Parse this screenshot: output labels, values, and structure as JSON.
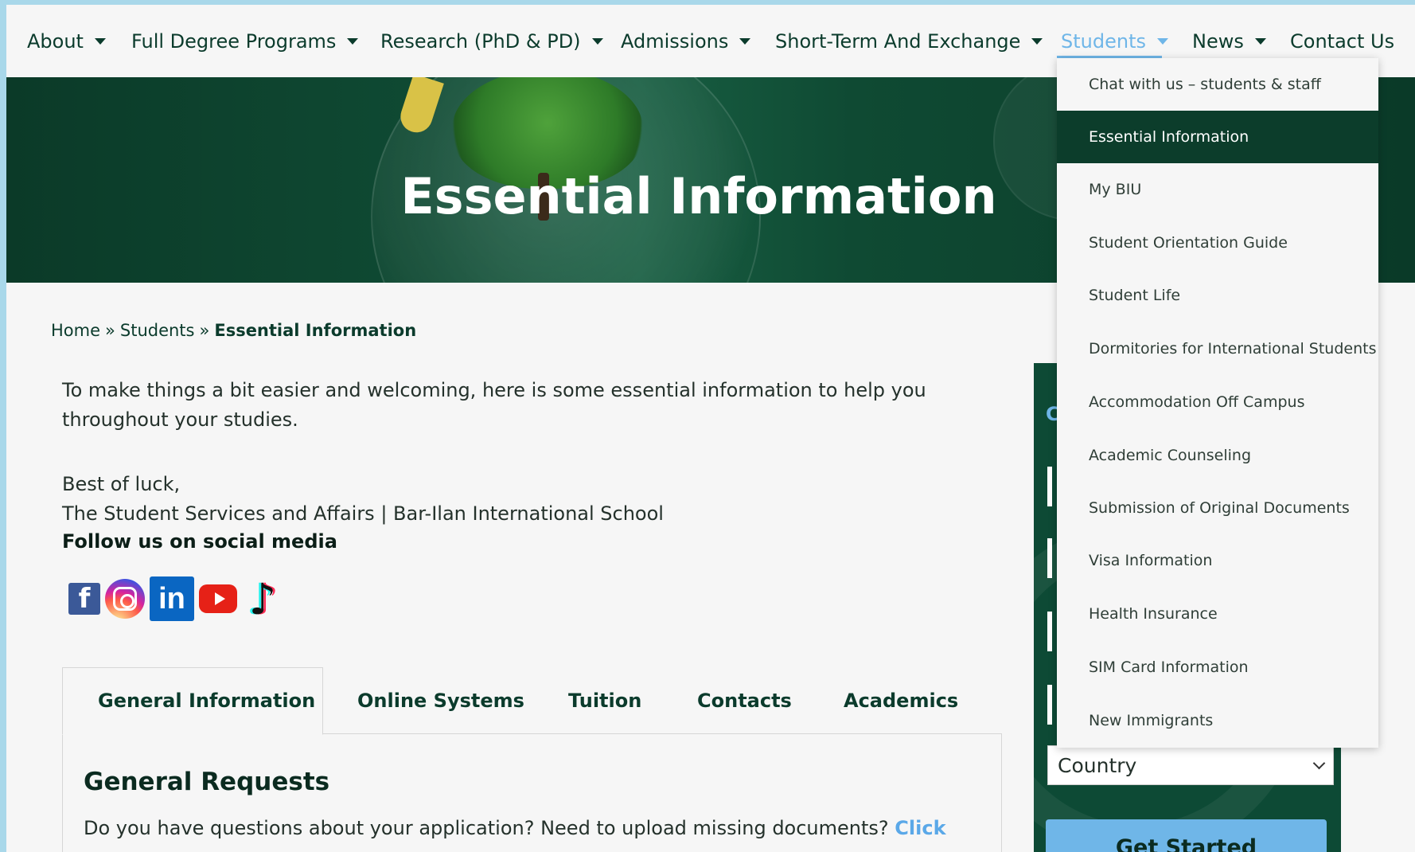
{
  "nav": {
    "items": [
      {
        "label": "About",
        "has_caret": true
      },
      {
        "label": "Full Degree Programs",
        "has_caret": true
      },
      {
        "label": "Research (PhD & PD)",
        "has_caret": true
      },
      {
        "label": "Admissions",
        "has_caret": true
      },
      {
        "label": "Short-Term And Exchange",
        "has_caret": true
      },
      {
        "label": "Students",
        "has_caret": true,
        "active": true
      },
      {
        "label": "News",
        "has_caret": true
      },
      {
        "label": "Contact Us",
        "has_caret": false
      }
    ]
  },
  "hero": {
    "title": "Essential Information"
  },
  "breadcrumb": {
    "home": "Home",
    "separator": "»",
    "parent": "Students",
    "current": "Essential Information"
  },
  "content": {
    "intro": "To make things a bit easier and welcoming, here is some essential information to help you throughout your studies.",
    "luck": "Best of luck,",
    "signature": "The Student Services and Affairs | Bar-Ilan International School",
    "follow": "Follow us on social media"
  },
  "social": {
    "icons": [
      "facebook-icon",
      "instagram-icon",
      "linkedin-icon",
      "youtube-icon",
      "tiktok-icon"
    ],
    "facebook_glyph": "f",
    "linkedin_glyph": "in",
    "tiktok_glyph": "♪"
  },
  "tabs": [
    {
      "label": "General Information",
      "active": true
    },
    {
      "label": "Online Systems"
    },
    {
      "label": "Tuition"
    },
    {
      "label": "Contacts"
    },
    {
      "label": "Academics"
    }
  ],
  "section": {
    "title": "General Requests",
    "text": "Do you have questions about your application? Need to upload missing documents?",
    "link": "Click"
  },
  "form": {
    "partial_heading": "C",
    "country_placeholder": "Country",
    "submit": "Get Started"
  },
  "dropdown": {
    "items": [
      {
        "label": "Chat with us – students & staff"
      },
      {
        "label": "Essential Information",
        "active": true
      },
      {
        "label": "My BIU"
      },
      {
        "label": "Student Orientation Guide"
      },
      {
        "label": "Student Life"
      },
      {
        "label": "Dormitories for International Students"
      },
      {
        "label": "Accommodation Off Campus"
      },
      {
        "label": "Academic Counseling"
      },
      {
        "label": "Submission of Original Documents"
      },
      {
        "label": "Visa Information"
      },
      {
        "label": "Health Insurance"
      },
      {
        "label": "SIM Card Information"
      },
      {
        "label": "New Immigrants"
      }
    ]
  },
  "colors": {
    "primary_dark_green": "#0c3d2b",
    "accent_blue": "#6fb6e8",
    "page_bg": "#f6f6f6",
    "frame_bg": "#a9d8ea"
  }
}
